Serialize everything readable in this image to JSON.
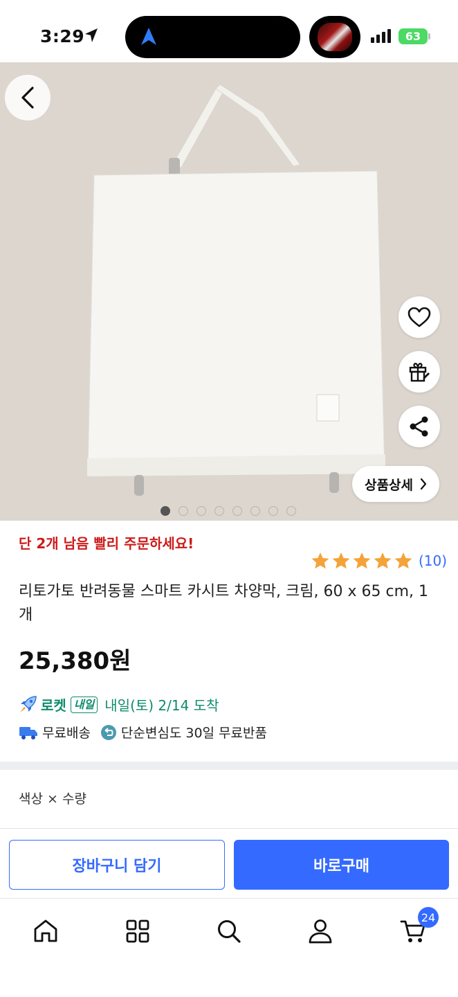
{
  "status_bar": {
    "time": "3:29",
    "battery": "63"
  },
  "hero": {
    "detail_button_label": "상품상세",
    "dots_count": 8,
    "active_dot": 0
  },
  "product": {
    "urgency": "단 2개 남음 빨리 주문하세요!",
    "rating": {
      "stars": 5,
      "count": "(10)"
    },
    "title": "리토가토 반려동물 스마트 카시트 차양막, 크림, 60 x 65 cm, 1개",
    "price": "25,380원",
    "rocket": {
      "label": "로켓",
      "badge": "내일",
      "arrival": "내일(토) 2/14 도착"
    },
    "benefits": {
      "free_shipping": "무료배송",
      "returns": "단순변심도 30일 무료반품"
    }
  },
  "options": {
    "label": "색상 × 수량"
  },
  "actions": {
    "cart_label": "장바구니 담기",
    "buy_label": "바로구매"
  },
  "bottom_nav": {
    "items": [
      "home-icon",
      "category-icon",
      "search-icon",
      "my-page-icon",
      "cart-icon"
    ],
    "cart_count": "24"
  },
  "colors": {
    "accent": "#346aff",
    "urgent": "#cc1b1b",
    "rocket": "#0f8a6a",
    "star": "#f4a33a"
  }
}
